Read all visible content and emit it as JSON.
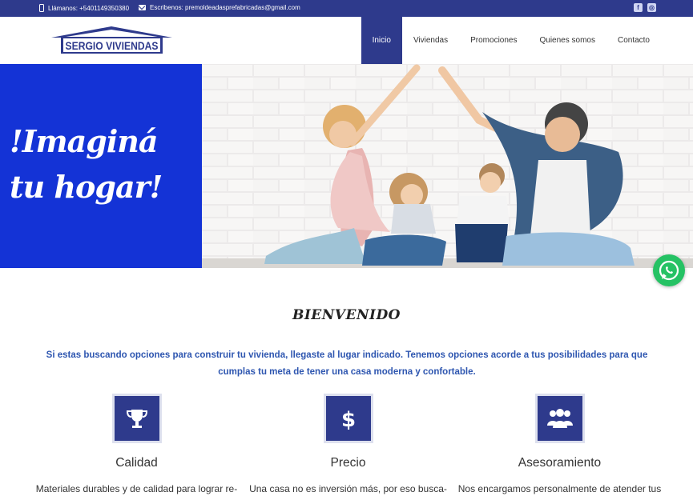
{
  "topbar": {
    "phone_icon": "phone-icon",
    "phone": "Llámanos: +5401149350380",
    "mail_icon": "envelope-icon",
    "email": "Escribenos: premoldeadasprefabricadas@gmail.com",
    "social": [
      "facebook-icon",
      "instagram-icon"
    ]
  },
  "header": {
    "logo_text": "SERGIO VIVIENDAS",
    "nav": [
      "Inicio",
      "Viviendas",
      "Promociones",
      "Quienes somos",
      "Contacto"
    ],
    "active": "Inicio"
  },
  "hero": {
    "title": "!Imaginá tu hogar!"
  },
  "whatsapp": {
    "icon": "whatsapp-icon"
  },
  "welcome": {
    "title": "BIENVENIDO",
    "text": "Si estas buscando opciones para construir tu vivienda, llegaste al lugar indicado. Tenemos opciones acorde a tus posibilidades para que cumplas tu meta de tener una casa moderna y confortable."
  },
  "features": [
    {
      "icon": "trophy-icon",
      "title": "Calidad",
      "text": "Materiales durables y de calidad para lograr re-"
    },
    {
      "icon": "dollar-icon",
      "title": "Precio",
      "text": "Una casa no es inversión más, por eso busca-"
    },
    {
      "icon": "users-icon",
      "title": "Asesoramiento",
      "text": "Nos encargamos personalmente de atender tus"
    }
  ],
  "colors": {
    "brand": "#2e3a8c",
    "hero_blue": "#1433d6",
    "welcome_text": "#2e56b0",
    "whatsapp": "#25c264"
  }
}
